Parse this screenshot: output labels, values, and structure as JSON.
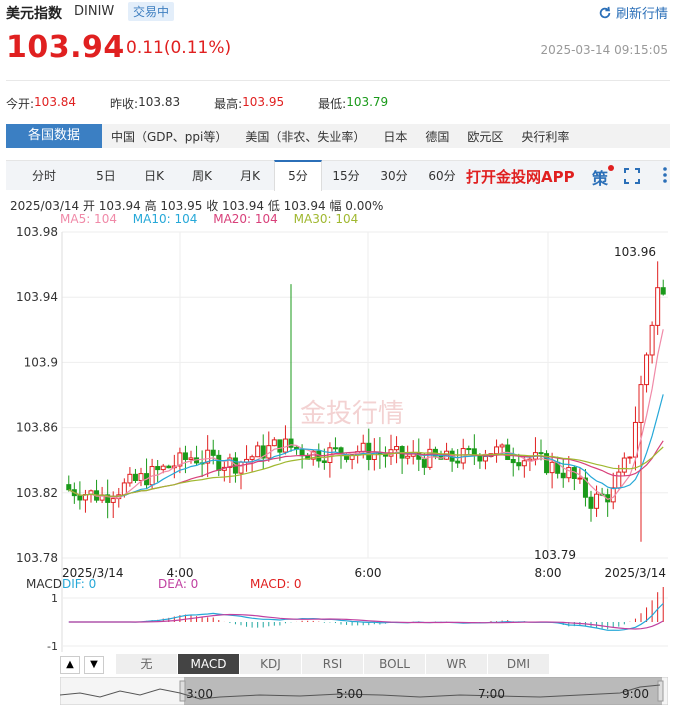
{
  "header": {
    "title": "美元指数",
    "code": "DINIW",
    "status": "交易中",
    "refresh_label": "刷新行情"
  },
  "quote": {
    "price": "103.94",
    "change": "0.11(0.11%)",
    "time": "2025-03-14 09:15:05"
  },
  "stats": {
    "open_label": "今开:",
    "open": "103.84",
    "prev_close_label": "昨收:",
    "prev_close": "103.83",
    "high_label": "最高:",
    "high": "103.95",
    "low_label": "最低:",
    "low": "103.79"
  },
  "data_tabs": [
    "各国数据",
    "中国（GDP、ppi等）",
    "美国（非农、失业率）",
    "日本",
    "德国",
    "欧元区",
    "央行利率"
  ],
  "period_tabs": [
    "分时",
    "5日",
    "日K",
    "周K",
    "月K",
    "5分",
    "15分",
    "30分",
    "60分"
  ],
  "active_period": "5分",
  "app_label": "打开金投网APP",
  "ce_label": "策",
  "bar_info": "2025/03/14  开 103.94  高 103.95  收 103.94  低 103.94  幅 0.00%",
  "ma_labels": {
    "ma5": "MA5: 104",
    "ma10": "MA10: 104",
    "ma20": "MA20: 104",
    "ma30": "MA30: 104"
  },
  "colors": {
    "up": "#e02020",
    "down": "#1a9a1a",
    "ma5": "#f08aa8",
    "ma10": "#26a8d8",
    "ma20": "#d8407a",
    "ma30": "#a0b830",
    "accent": "#2b6fb8"
  },
  "watermark": "金投行情",
  "chart_data": {
    "type": "candlestick",
    "y_ticks": [
      "103.98",
      "103.94",
      "103.9",
      "103.86",
      "103.82",
      "103.78"
    ],
    "ylim": [
      103.78,
      103.98
    ],
    "x_labels": [
      "2025/3/14",
      "4:00",
      "6:00",
      "8:00",
      "2025/3/14"
    ],
    "max_label": "103.96",
    "min_label": "103.79",
    "macd": {
      "dif_label": "DIF: 0",
      "dea_label": "DEA: 0",
      "macd_label": "MACD: 0",
      "y_ticks": [
        "1",
        "-1"
      ],
      "prefix": "MACD"
    }
  },
  "indicator_tabs": [
    "无",
    "MACD",
    "KDJ",
    "RSI",
    "BOLL",
    "WR",
    "DMI"
  ],
  "active_indicator": "MACD",
  "timeline_labels": [
    "3:00",
    "5:00",
    "7:00",
    "9:00"
  ]
}
